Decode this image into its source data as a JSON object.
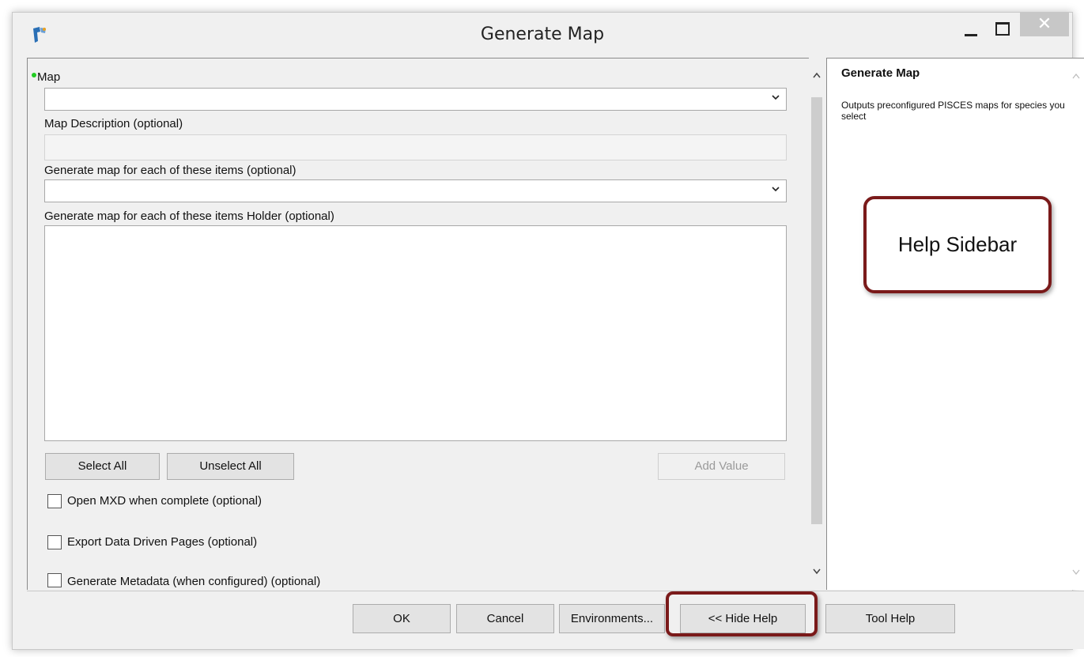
{
  "window": {
    "title": "Generate Map",
    "close_glyph": "✕"
  },
  "form": {
    "map_label": "Map",
    "map_value": "",
    "map_description_label": "Map Description (optional)",
    "items_label": "Generate map for each of these items (optional)",
    "items_value": "",
    "holder_label": "Generate map for each of these items Holder (optional)",
    "select_all": "Select All",
    "unselect_all": "Unselect All",
    "add_value": "Add Value",
    "open_mxd": "Open MXD when complete (optional)",
    "export_ddp": "Export Data Driven Pages (optional)",
    "generate_metadata": "Generate Metadata (when configured) (optional)"
  },
  "help": {
    "title": "Generate Map",
    "description": "Outputs preconfigured PISCES maps for species you select",
    "callout": "Help Sidebar"
  },
  "buttons": {
    "ok": "OK",
    "cancel": "Cancel",
    "environments": "Environments...",
    "hide_help": "<< Hide Help",
    "tool_help": "Tool Help"
  },
  "colors": {
    "required_dot": "#22cc22",
    "callout_border": "#7a1a1a"
  }
}
